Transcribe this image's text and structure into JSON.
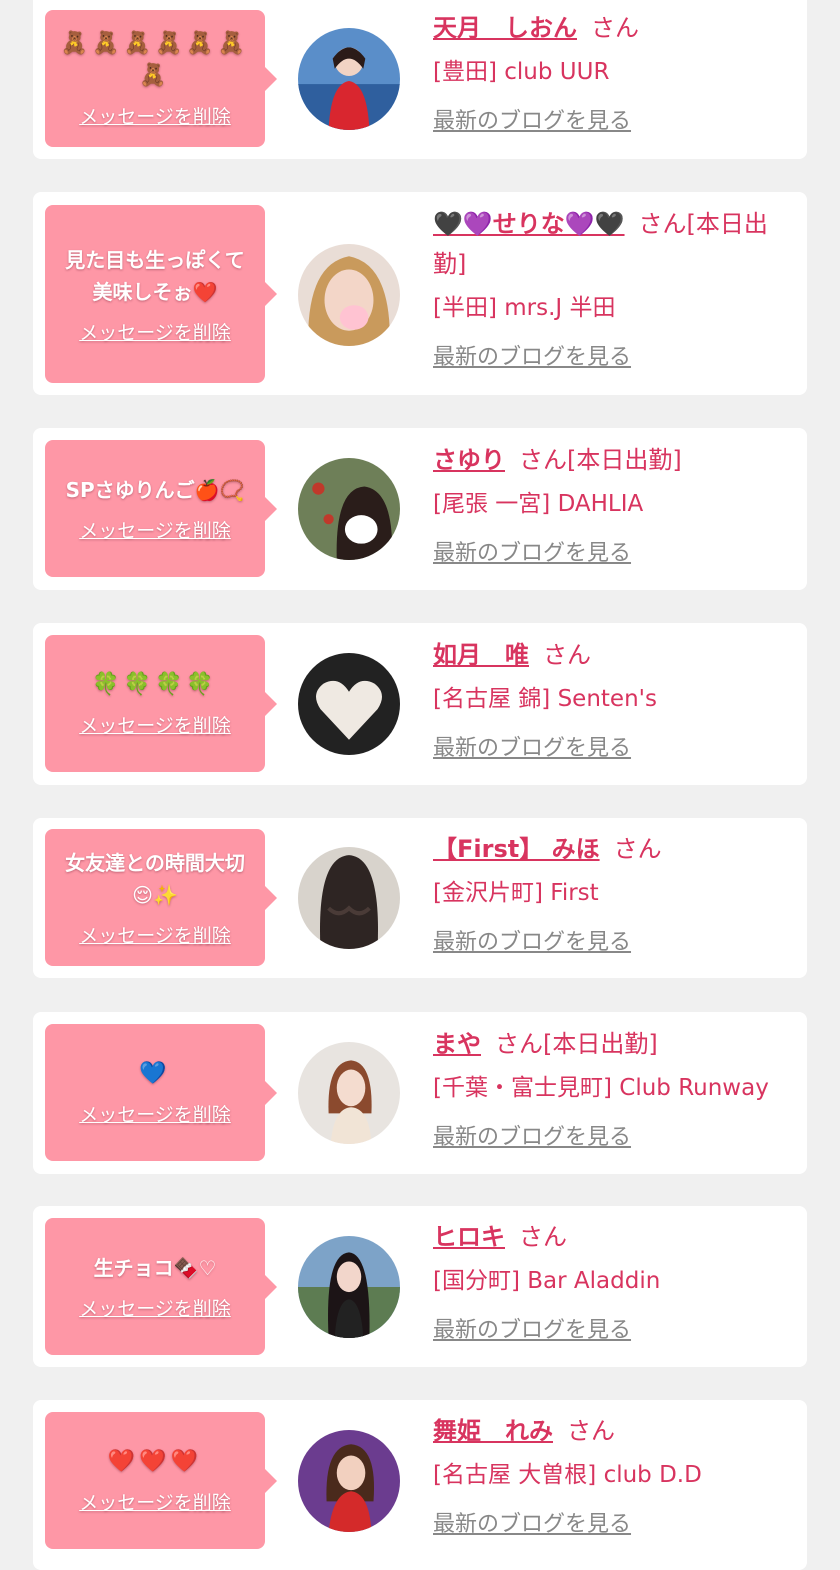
{
  "delete_label": "メッセージを削除",
  "blog_label": "最新のブログを見る",
  "colors": {
    "page_bg": "#f0f0f0",
    "card_bg": "#ffffff",
    "bubble_bg": "#fe97a6",
    "name_color": "#d8345f",
    "link_gray": "#888888"
  },
  "entries": [
    {
      "message": "🧸🧸🧸🧸🧸🧸🧸",
      "name": "天月　しおん",
      "suffix": "さん",
      "shop": "[豊田] club UUR",
      "avatar_icon": "woman-portrait-red-dress"
    },
    {
      "message": "見た目も生っぽくて美味しそぉ❤️",
      "name": "🖤💜せりな💜🖤",
      "suffix": "さん[本日出勤]",
      "shop": "[半田] mrs.J 半田",
      "avatar_icon": "woman-portrait-blonde"
    },
    {
      "message": "SPさゆりんご🍎📿",
      "name": "さゆり",
      "suffix": "さん[本日出勤]",
      "shop": "[尾張 一宮] DAHLIA",
      "avatar_icon": "woman-portrait-dark-hair"
    },
    {
      "message": "🍀🍀🍀🍀",
      "name": "如月　唯",
      "suffix": "さん",
      "shop": "[名古屋 錦] Senten's",
      "avatar_icon": "heart-object-photo"
    },
    {
      "message": "女友達との時間大切😌✨",
      "name": "【First】 みほ",
      "suffix": "さん",
      "shop": "[金沢片町] First",
      "avatar_icon": "curly-hair-back-photo"
    },
    {
      "message": "💙",
      "name": "まや",
      "suffix": "さん[本日出勤]",
      "shop": "[千葉・富士見町] Club Runway",
      "avatar_icon": "woman-portrait-light"
    },
    {
      "message": "生チョコ🍫♡",
      "name": "ヒロキ",
      "suffix": "さん",
      "shop": "[国分町] Bar Aladdin",
      "avatar_icon": "woman-portrait-outdoor"
    },
    {
      "message": "❤️❤️❤️",
      "name": "舞姫　れみ",
      "suffix": "さん",
      "shop": "[名古屋 大曽根] club D.D",
      "avatar_icon": "woman-portrait-purple-bg"
    }
  ]
}
